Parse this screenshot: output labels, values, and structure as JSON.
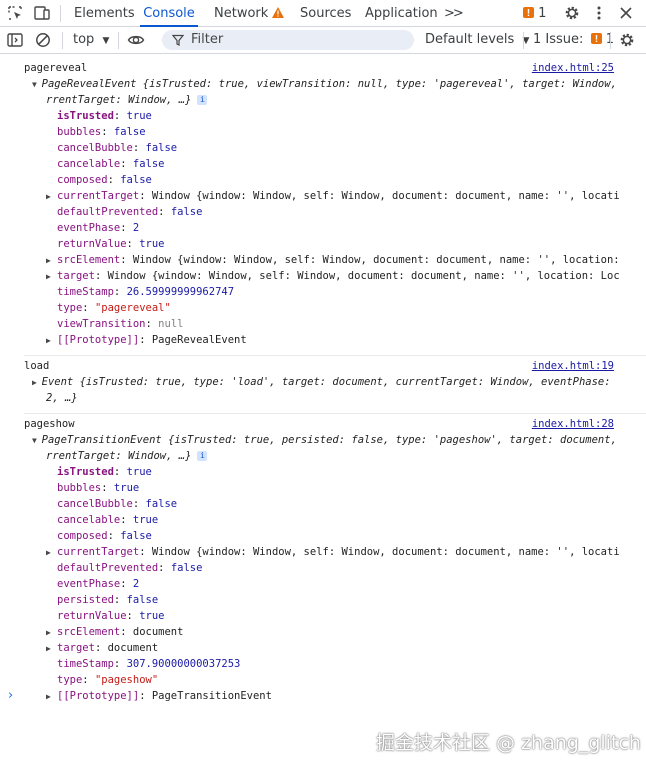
{
  "tabs": {
    "elements": "Elements",
    "console": "Console",
    "network": "Network",
    "sources": "Sources",
    "application": "Application",
    "more": ">>",
    "warnings_count": "1"
  },
  "toolbar": {
    "context": "top",
    "filter_placeholder": "Filter",
    "levels": "Default levels",
    "issues_label": "1 Issue:",
    "issues_count": "1"
  },
  "messages": [
    {
      "text": "pagereveal",
      "source": "index.html:25",
      "summary_1": "PageRevealEvent {isTrusted: true, viewTransition: null, type: 'pagereveal', target: Window, cu",
      "summary_2": "rrentTarget: Window, …}",
      "props": [
        {
          "key": "isTrusted",
          "value": "true",
          "bold": true
        },
        {
          "key": "bubbles",
          "value": "false"
        },
        {
          "key": "cancelBubble",
          "value": "false"
        },
        {
          "key": "cancelable",
          "value": "false"
        },
        {
          "key": "composed",
          "value": "false"
        },
        {
          "key": "currentTarget",
          "value": "Window {window: Window, self: Window, document: document, name: '', location:",
          "expandable": true
        },
        {
          "key": "defaultPrevented",
          "value": "false"
        },
        {
          "key": "eventPhase",
          "value": "2"
        },
        {
          "key": "returnValue",
          "value": "true"
        },
        {
          "key": "srcElement",
          "value": "Window {window: Window, self: Window, document: document, name: '', location: Loc",
          "expandable": true
        },
        {
          "key": "target",
          "value": "Window {window: Window, self: Window, document: document, name: '', location: Locatio",
          "expandable": true
        },
        {
          "key": "timeStamp",
          "value": "26.59999999962747"
        },
        {
          "key": "type",
          "value": "\"pagereveal\""
        },
        {
          "key": "viewTransition",
          "value": "null"
        },
        {
          "key": "[[Prototype]]",
          "value": "PageRevealEvent",
          "expandable": true
        }
      ]
    },
    {
      "text": "load",
      "source": "index.html:19",
      "summary_1": "Event {isTrusted: true, type: 'load', target: document, currentTarget: Window, eventPhase:",
      "summary_2": "2, …}"
    },
    {
      "text": "pageshow",
      "source": "index.html:28",
      "summary_1": "PageTransitionEvent {isTrusted: true, persisted: false, type: 'pageshow', target: document, cu",
      "summary_2": "rrentTarget: Window, …}",
      "props": [
        {
          "key": "isTrusted",
          "value": "true",
          "bold": true
        },
        {
          "key": "bubbles",
          "value": "true"
        },
        {
          "key": "cancelBubble",
          "value": "false"
        },
        {
          "key": "cancelable",
          "value": "true"
        },
        {
          "key": "composed",
          "value": "false"
        },
        {
          "key": "currentTarget",
          "value": "Window {window: Window, self: Window, document: document, name: '', location:",
          "expandable": true
        },
        {
          "key": "defaultPrevented",
          "value": "false"
        },
        {
          "key": "eventPhase",
          "value": "2"
        },
        {
          "key": "persisted",
          "value": "false"
        },
        {
          "key": "returnValue",
          "value": "true"
        },
        {
          "key": "srcElement",
          "value": "document",
          "expandable": true
        },
        {
          "key": "target",
          "value": "document",
          "expandable": true
        },
        {
          "key": "timeStamp",
          "value": "307.90000000037253"
        },
        {
          "key": "type",
          "value": "\"pageshow\""
        },
        {
          "key": "[[Prototype]]",
          "value": "PageTransitionEvent",
          "expandable": true
        }
      ]
    }
  ],
  "watermark": "掘金技术社区 @ zhang_glitch",
  "colors": {
    "accent": "#0b57d0",
    "warning": "#e8710a"
  }
}
